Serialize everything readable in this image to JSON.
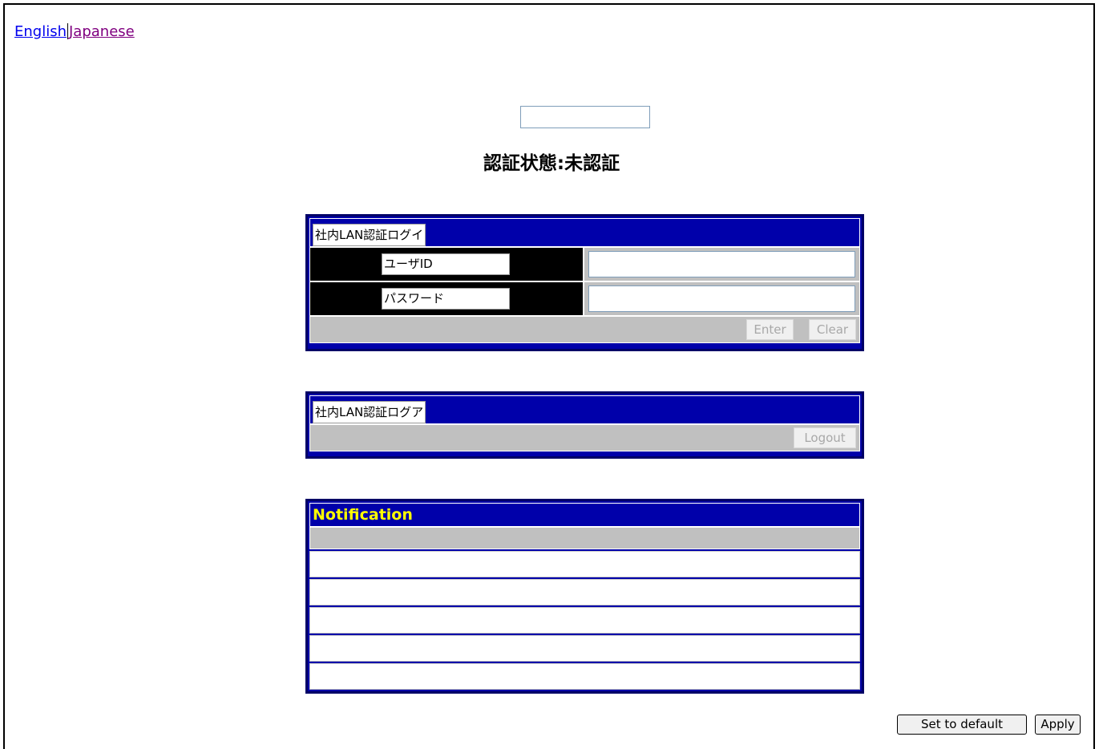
{
  "language_links": {
    "english": "English",
    "japanese": "Japanese"
  },
  "status": {
    "text": "認証状態:未認証"
  },
  "login_panel": {
    "caption": "社内LAN認証ログイ",
    "user_id_label": "ユーザID",
    "password_label": "パスワード",
    "enter_button": "Enter",
    "clear_button": "Clear"
  },
  "logout_panel": {
    "caption": "社内LAN認証ログア",
    "logout_button": "Logout"
  },
  "notification_panel": {
    "title": "Notification",
    "lines": [
      "",
      "",
      "",
      "",
      ""
    ]
  },
  "footer": {
    "set_default_button": "Set to default",
    "apply_button": "Apply"
  },
  "colors": {
    "panel_blue": "#0000aa",
    "panel_border": "#000066",
    "notification_title": "#ffff00",
    "gray_row": "#c0c0c0"
  }
}
